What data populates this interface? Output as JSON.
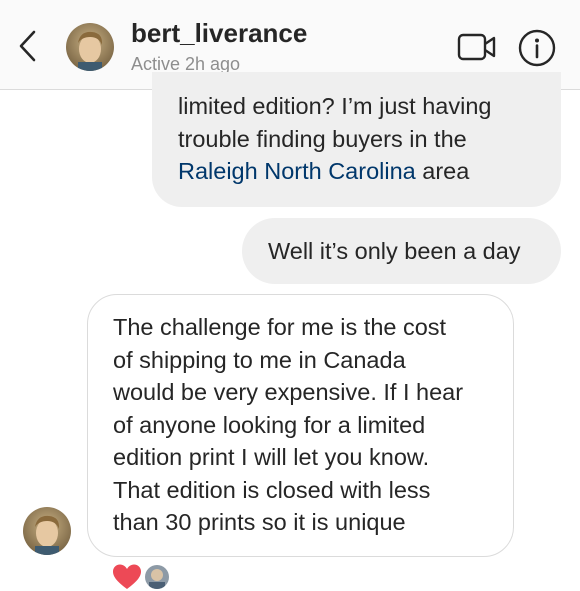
{
  "header": {
    "username": "bert_liverance",
    "status": "Active 2h ago",
    "back_icon": "chevron-left-icon",
    "video_icon": "video-camera-icon",
    "info_icon": "info-icon"
  },
  "messages": [
    {
      "from": "me",
      "lines": [
        "limited edition? I’m just having",
        "trouble finding buyers in the"
      ],
      "link_text": "Raleigh North Carolina",
      "link_suffix": " area"
    },
    {
      "from": "me",
      "text": "Well it’s only been a day"
    },
    {
      "from": "bert_liverance",
      "lines": [
        "The challenge for me is the cost",
        "of shipping to me in Canada",
        "would be very expensive. If I hear",
        "of anyone looking for a limited",
        "edition print I will let you know.",
        "That edition is closed with less",
        "than 30 prints so it is unique"
      ]
    }
  ],
  "reactions": {
    "heart_icon": "heart-icon",
    "heart_color": "#ed4956"
  },
  "colors": {
    "link": "#00376b",
    "bubble_gray": "#efefef",
    "bubble_border": "#dbdbdb",
    "secondary_text": "#8e8e8e"
  }
}
